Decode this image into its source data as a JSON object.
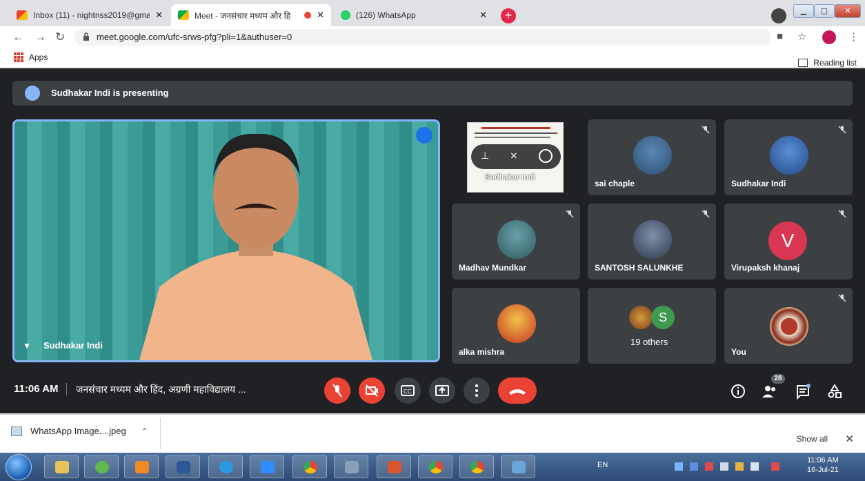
{
  "browser": {
    "tabs": [
      {
        "label": "Inbox (11) - nightnss2019@gma",
        "favicon": "gmail-icon",
        "active": false
      },
      {
        "label": "Meet - जनसंचार मध्यम और हि",
        "favicon": "meet-icon",
        "active": true
      },
      {
        "label": "(126) WhatsApp",
        "favicon": "whatsapp-icon",
        "active": false
      }
    ],
    "new_tab": "+",
    "url": "meet.google.com/ufc-srws-pfg?pli=1&authuser=0",
    "bookmarks_apps": "Apps",
    "reading_list": "Reading list"
  },
  "meet": {
    "presenting_banner": "Sudhakar Indi is presenting",
    "main_speaker": "Sudhakar Indi",
    "screen_share_label": "Sudhakar Indi",
    "participants": [
      {
        "name": "sai chaple"
      },
      {
        "name": "Sudhakar Indi"
      },
      {
        "name": "Madhav Mundkar"
      },
      {
        "name": "SANTOSH SALUNKHE"
      },
      {
        "name": "Virupaksh khanaj",
        "initial": "V"
      },
      {
        "name": "alka mishra"
      },
      {
        "name": "19 others",
        "initial": "S"
      },
      {
        "name": "You"
      }
    ],
    "time": "11:06 AM",
    "meeting_title": "जनसंचार मध्यम और हिंद, अग्रणी महाविद्यालय ...",
    "people_count": "28",
    "colors": {
      "accent_blue": "#8ab4f8",
      "end_call_red": "#ea4335",
      "tile_bg": "#3c4043"
    }
  },
  "downloads": {
    "file": "WhatsApp Image....jpeg",
    "show_all": "Show all"
  },
  "taskbar": {
    "lang": "EN",
    "clock_time": "11:06 AM",
    "clock_date": "16-Jul-21"
  }
}
